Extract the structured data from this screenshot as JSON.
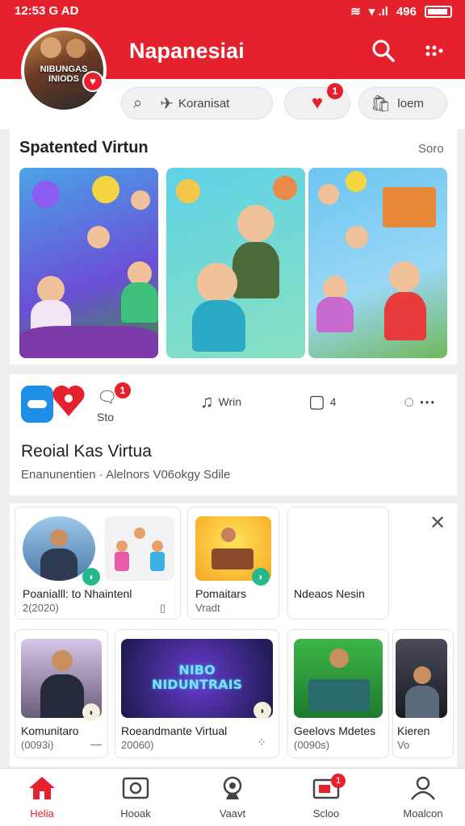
{
  "status_bar": {
    "time": "12:53 G AD",
    "signal": "▾ .ıl",
    "battery": "496"
  },
  "header": {
    "title": "Napanesiai",
    "avatar_text": "NIBUNGAS INIODS",
    "avatar_badge": "♥"
  },
  "pills": [
    {
      "label": "Koranisat",
      "icon": "plane-icon"
    },
    {
      "label": "",
      "icon": "heart-icon",
      "badge": "1"
    },
    {
      "label": "loem",
      "icon": "bag-icon"
    }
  ],
  "featured": {
    "title": "Spatented Virtun",
    "more": "Soro"
  },
  "post": {
    "comment_count": "Sto",
    "comment_badge": "1",
    "share_label": "Wrin",
    "save_label": "4",
    "title": "Reoial Kas Virtua",
    "subtitle": "Enanunentien · Alelnors V06okgy Sdile"
  },
  "row1": [
    {
      "title": "Poanialll: to Nhaintenl",
      "sub": "2(2020)"
    },
    {
      "title": "Pomaitars",
      "sub": "Vradt"
    },
    {
      "title": "Ndeaos Nesin",
      "sub": ""
    }
  ],
  "row2": [
    {
      "title": "Komunitaro",
      "sub": "(0093i)"
    },
    {
      "title": "Roeandmante Virtual",
      "sub": "20060)",
      "overlay": "NIBO NIDUNTRAIS"
    },
    {
      "title": "Geelovs Mdetes",
      "sub": "(0090s)"
    },
    {
      "title": "Kieren",
      "sub": "Vo"
    }
  ],
  "bottom_nav": [
    {
      "label": "Helia",
      "icon": "home-icon",
      "active": true
    },
    {
      "label": "Hooak",
      "icon": "radio-icon"
    },
    {
      "label": "Vaavt",
      "icon": "webcam-icon"
    },
    {
      "label": "Scloo",
      "icon": "tv-icon",
      "badge": "1"
    },
    {
      "label": "Moalcon",
      "icon": "user-icon"
    }
  ],
  "colors": {
    "accent": "#e5212d",
    "background": "#efefef"
  }
}
